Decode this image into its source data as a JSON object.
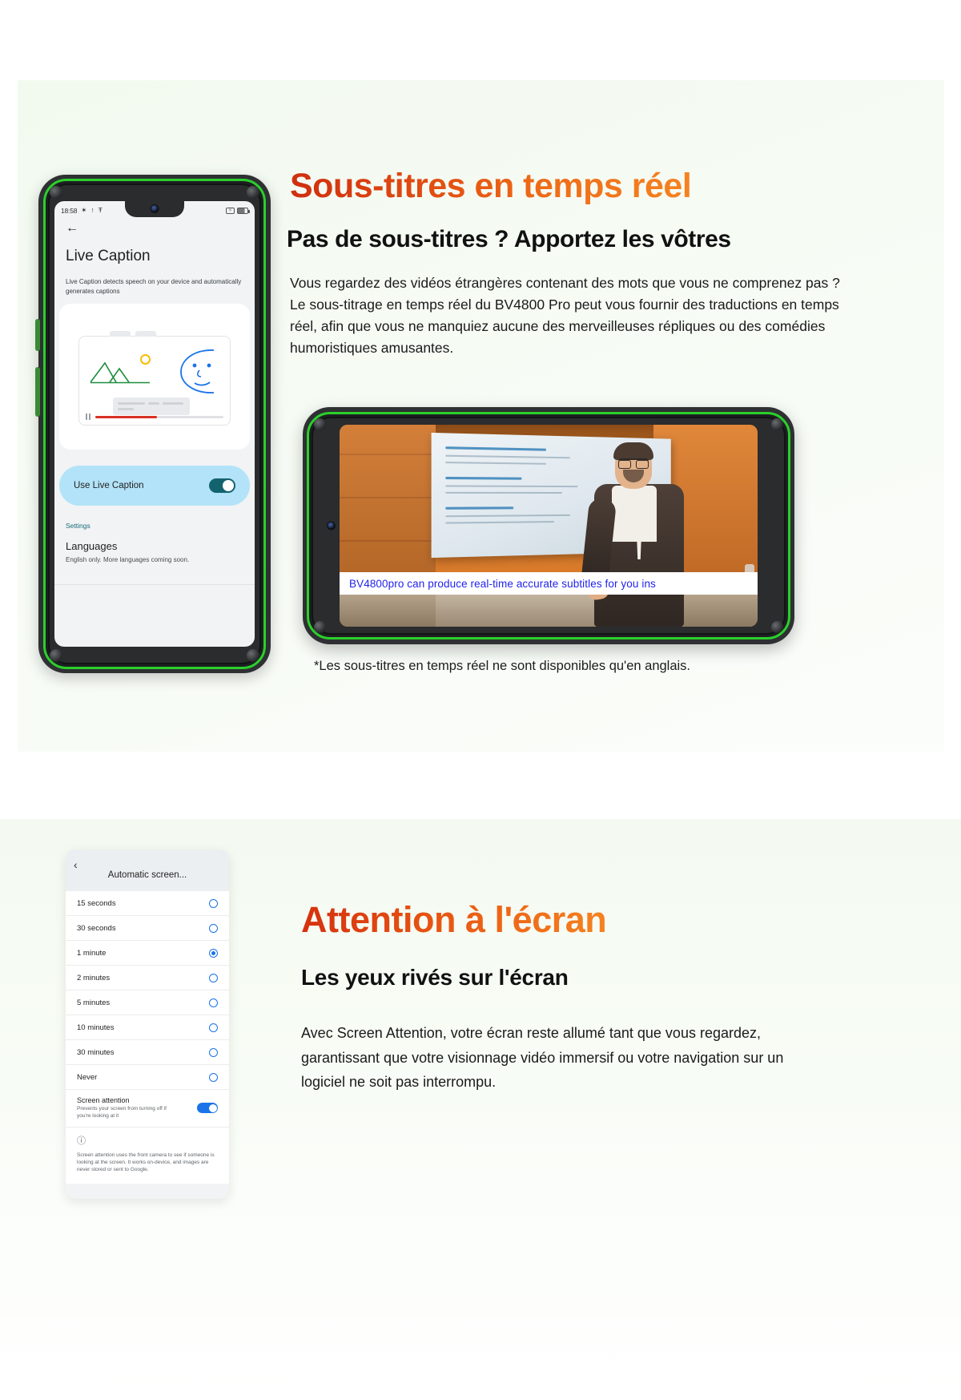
{
  "section_one": {
    "heading": "Sous-titres en temps réel",
    "subheading": "Pas de sous-titres ? Apportez les vôtres",
    "body": "Vous regardez des vidéos étrangères contenant des mots que vous ne comprenez pas ? Le sous-titrage en temps réel du BV4800 Pro peut vous fournir des traductions en temps réel, afin que vous ne manquiez aucune des merveilleuses répliques ou des comédies humoristiques amusantes.",
    "footnote": "*Les sous-titres en temps réel ne sont disponibles qu'en anglais.",
    "phone_portrait": {
      "status_bar": {
        "time": "18:58",
        "bluetooth_icon": "✶",
        "upload_icon": "↑",
        "accessibility_icon": "Ŧ",
        "close_icon": "×",
        "battery_icon": "battery"
      },
      "back_icon": "←",
      "title": "Live Caption",
      "description": "Live Caption detects speech on your device and automatically generates captions",
      "toggle_row": {
        "label": "Use Live Caption",
        "state": "on"
      },
      "settings_label": "Settings",
      "languages_title": "Languages",
      "languages_sub": "English only. More languages coming soon."
    },
    "phone_landscape": {
      "caption": "BV4800pro can produce real-time accurate subtitles for you ins"
    }
  },
  "section_two": {
    "heading": "Attention à l'écran",
    "subheading": "Les yeux rivés sur l'écran",
    "body": "Avec Screen Attention, votre écran reste allumé tant que vous regardez, garantissant que votre visionnage vidéo immersif ou votre navigation sur un logiciel ne soit pas interrompu.",
    "phone_settings": {
      "back_icon": "‹",
      "header_title": "Automatic screen...",
      "options": [
        {
          "label": "15 seconds",
          "selected": false
        },
        {
          "label": "30 seconds",
          "selected": false
        },
        {
          "label": "1 minute",
          "selected": true
        },
        {
          "label": "2 minutes",
          "selected": false
        },
        {
          "label": "5 minutes",
          "selected": false
        },
        {
          "label": "10 minutes",
          "selected": false
        },
        {
          "label": "30 minutes",
          "selected": false
        },
        {
          "label": "Never",
          "selected": false
        }
      ],
      "screen_attention": {
        "title": "Screen attention",
        "subtitle": "Prevents your screen from turning off if you're looking at it",
        "state": "on"
      },
      "footer_icon": "ⓘ",
      "footer_text": "Screen attention uses the front camera to see if someone is looking at the screen. It works on-device, and images are never stored or sent to Google."
    }
  },
  "colors": {
    "accent_red": "#cf2f10",
    "accent_orange": "#f68220",
    "phone_green": "#2ad02a",
    "toggle_blue": "#1a73e8",
    "toggle_teal": "#13636e",
    "caption_blue": "#2222ee",
    "panel_bg": "#f2faf0"
  }
}
